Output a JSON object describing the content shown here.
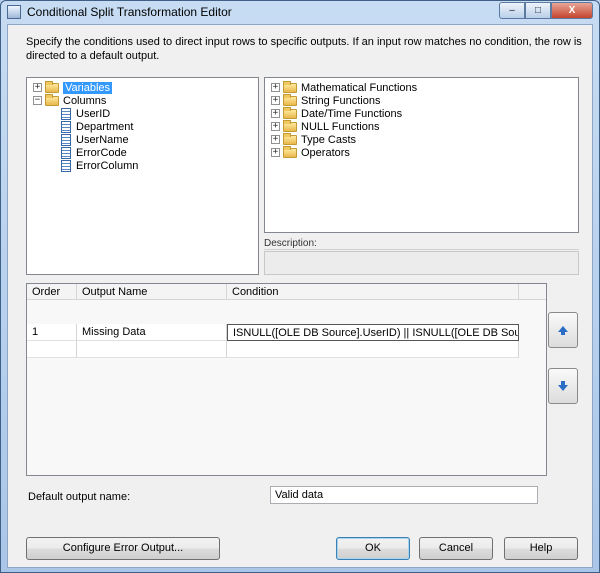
{
  "window": {
    "title": "Conditional Split Transformation Editor",
    "controls": {
      "minimize": "–",
      "maximize": "□",
      "close": "X"
    }
  },
  "instructions": "Specify the conditions used to direct input rows to specific outputs. If an input row matches no condition, the row is directed to a default output.",
  "left_tree": {
    "variables": "Variables",
    "columns_folder": "Columns",
    "columns": [
      "UserID",
      "Department",
      "UserName",
      "ErrorCode",
      "ErrorColumn"
    ]
  },
  "right_tree": {
    "items": [
      "Mathematical Functions",
      "String Functions",
      "Date/Time Functions",
      "NULL Functions",
      "Type Casts",
      "Operators"
    ]
  },
  "description": {
    "label": "Description:",
    "value": ""
  },
  "grid": {
    "headers": {
      "order": "Order",
      "output_name": "Output Name",
      "condition": "Condition"
    },
    "rows": [
      {
        "order": "1",
        "output_name": "Missing Data",
        "condition": "ISNULL([OLE DB Source].UserID) || ISNULL([OLE DB Source].Depa..."
      }
    ]
  },
  "icons": {
    "move_up": "arrow-up-icon",
    "move_down": "arrow-down-icon"
  },
  "default_output": {
    "label": "Default output name:",
    "value": "Valid data"
  },
  "buttons": {
    "configure_error": "Configure Error Output...",
    "ok": "OK",
    "cancel": "Cancel",
    "help": "Help"
  }
}
